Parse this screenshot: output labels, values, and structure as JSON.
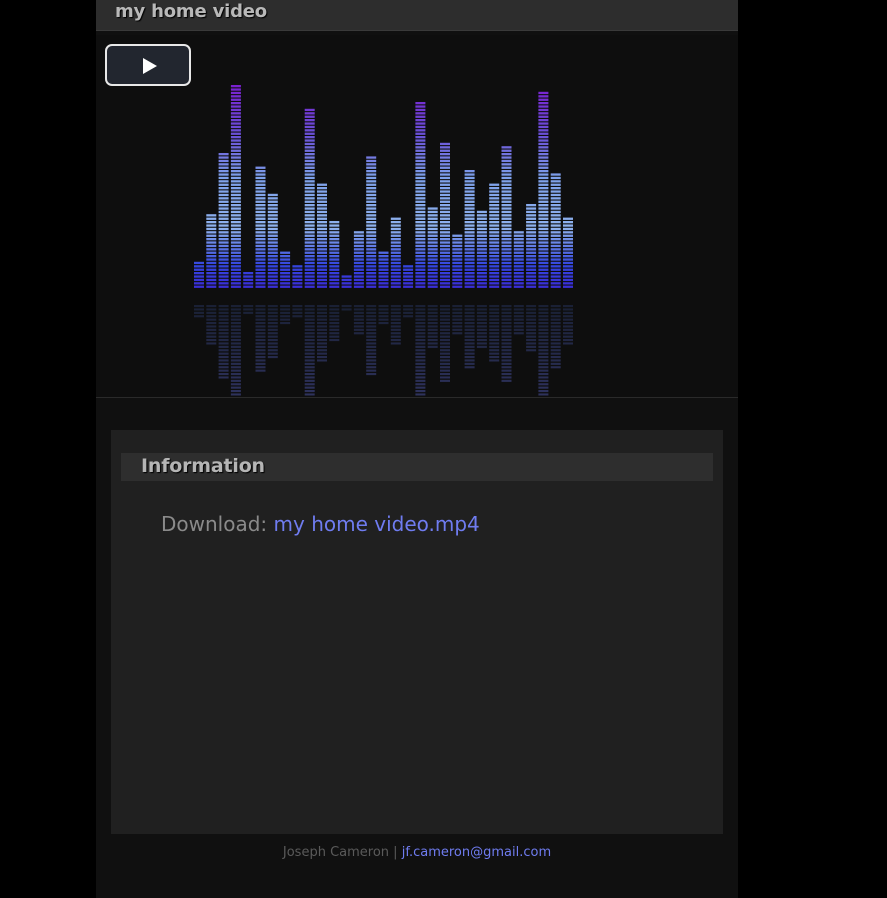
{
  "header": {
    "title": "my home video"
  },
  "player": {
    "play_icon": "play-icon",
    "equalizer": {
      "levels": [
        0.13,
        0.36,
        0.67,
        1.0,
        0.09,
        0.6,
        0.47,
        0.18,
        0.12,
        0.89,
        0.52,
        0.34,
        0.06,
        0.28,
        0.65,
        0.18,
        0.35,
        0.12,
        0.91,
        0.4,
        0.71,
        0.27,
        0.59,
        0.38,
        0.51,
        0.7,
        0.28,
        0.41,
        0.96,
        0.57,
        0.35
      ],
      "colors": {
        "low": "#3a2bd6",
        "mid": "#8fb2ee",
        "high": "#7a1fd0"
      }
    }
  },
  "info": {
    "heading": "Information",
    "download_label": "Download:",
    "download_link": "my home video.mp4"
  },
  "footer": {
    "author": "Joseph Cameron",
    "separator": "|",
    "email": "jf.cameron@gmail.com"
  },
  "colors": {
    "background": "#000000",
    "page": "#101010",
    "link": "#6f7cf0"
  }
}
